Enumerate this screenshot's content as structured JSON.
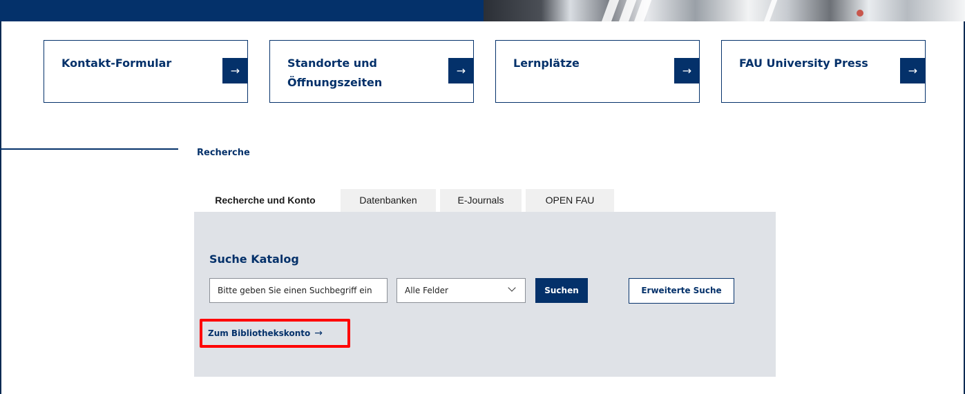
{
  "cards": [
    {
      "title": "Kontakt-Formular",
      "arrow": "→"
    },
    {
      "title": "Standorte und Öffnungszeiten",
      "arrow": "→"
    },
    {
      "title": "Lernplätze",
      "arrow": "→"
    },
    {
      "title": "FAU University Press",
      "arrow": "→"
    }
  ],
  "section": {
    "label": "Recherche"
  },
  "tabs": [
    {
      "label": "Recherche und Konto",
      "active": true
    },
    {
      "label": "Datenbanken",
      "active": false
    },
    {
      "label": "E-Journals",
      "active": false
    },
    {
      "label": "OPEN FAU",
      "active": false
    }
  ],
  "search": {
    "title": "Suche Katalog",
    "placeholder": "Bitte geben Sie einen Suchbegriff ein",
    "field_select": "Alle Felder",
    "submit_label": "Suchen",
    "advanced_label": "Erweiterte Suche",
    "account_link": "Zum Bibliothekskonto",
    "account_arrow": "→"
  },
  "colors": {
    "brand_navy": "#04316a",
    "panel_bg": "#dfe2e7",
    "highlight": "#ff0000"
  }
}
